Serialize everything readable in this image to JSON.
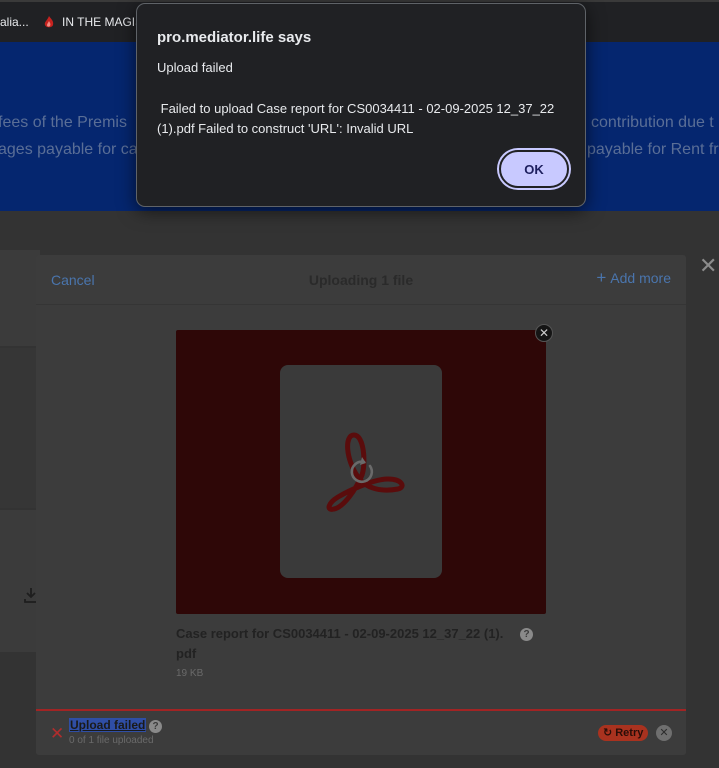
{
  "bookmarks": [
    {
      "label": "alia...",
      "icon": "bookmark-icon"
    },
    {
      "label": "IN THE MAGIS",
      "icon": "flame-icon"
    }
  ],
  "background_page": {
    "line1_left": "fees of the Premis",
    "line1_right": "contribution due t",
    "line2_left": "ages payable for ca",
    "line2_right": "payable for Rent fr"
  },
  "alert": {
    "title": "pro.mediator.life says",
    "message_line1": "Upload failed",
    "message_line2": " Failed to upload Case report for CS0034411 - 02-09-2025 12_37_22 (1).pdf Failed to construct 'URL': Invalid URL",
    "ok_label": "OK"
  },
  "uploader": {
    "cancel_label": "Cancel",
    "title": "Uploading 1 file",
    "add_more_label": "Add more",
    "file": {
      "name": "Case report for CS0034411 - 02-09-2025 12_37_22 (1). pdf",
      "size": "19 KB",
      "icon": "pdf-acrobat-icon"
    },
    "status": {
      "title": "Upload failed",
      "subtitle": "0 of 1 file uploaded",
      "retry_label": "Retry"
    }
  },
  "colors": {
    "accent_link": "#4a75ad",
    "error": "#a22424",
    "ok_button": "#c8c9ff",
    "hero": "#05266f"
  }
}
